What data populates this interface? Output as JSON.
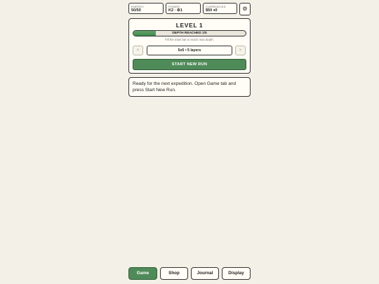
{
  "stats": {
    "energy": {
      "label": "ENERGY",
      "value": "50/50"
    },
    "power": {
      "label": "POWER",
      "value": "K2 · ⚙1"
    },
    "currencies": {
      "label": "CURRENCIES",
      "value": "$50 ♦0"
    }
  },
  "settings_icon": "gear-icon",
  "settings_glyph": "⚙",
  "panel": {
    "title": "LEVEL 1",
    "depth_label": "DEPTH REACHED 1/5",
    "depth_progress": 0.2,
    "hint": "Fill the main bar to reach max depth.",
    "prev_glyph": "<",
    "next_glyph": ">",
    "config": "5x5 • 5 layers",
    "start_label": "START NEW RUN"
  },
  "message": "Ready for the next expedition. Open Game tab and press Start New Run.",
  "nav": {
    "game": "Game",
    "shop": "Shop",
    "journal": "Journal",
    "display": "Display",
    "active": "game"
  },
  "colors": {
    "accent": "#4f8b59",
    "background": "#f3f0e7",
    "card": "#fffdf6"
  }
}
